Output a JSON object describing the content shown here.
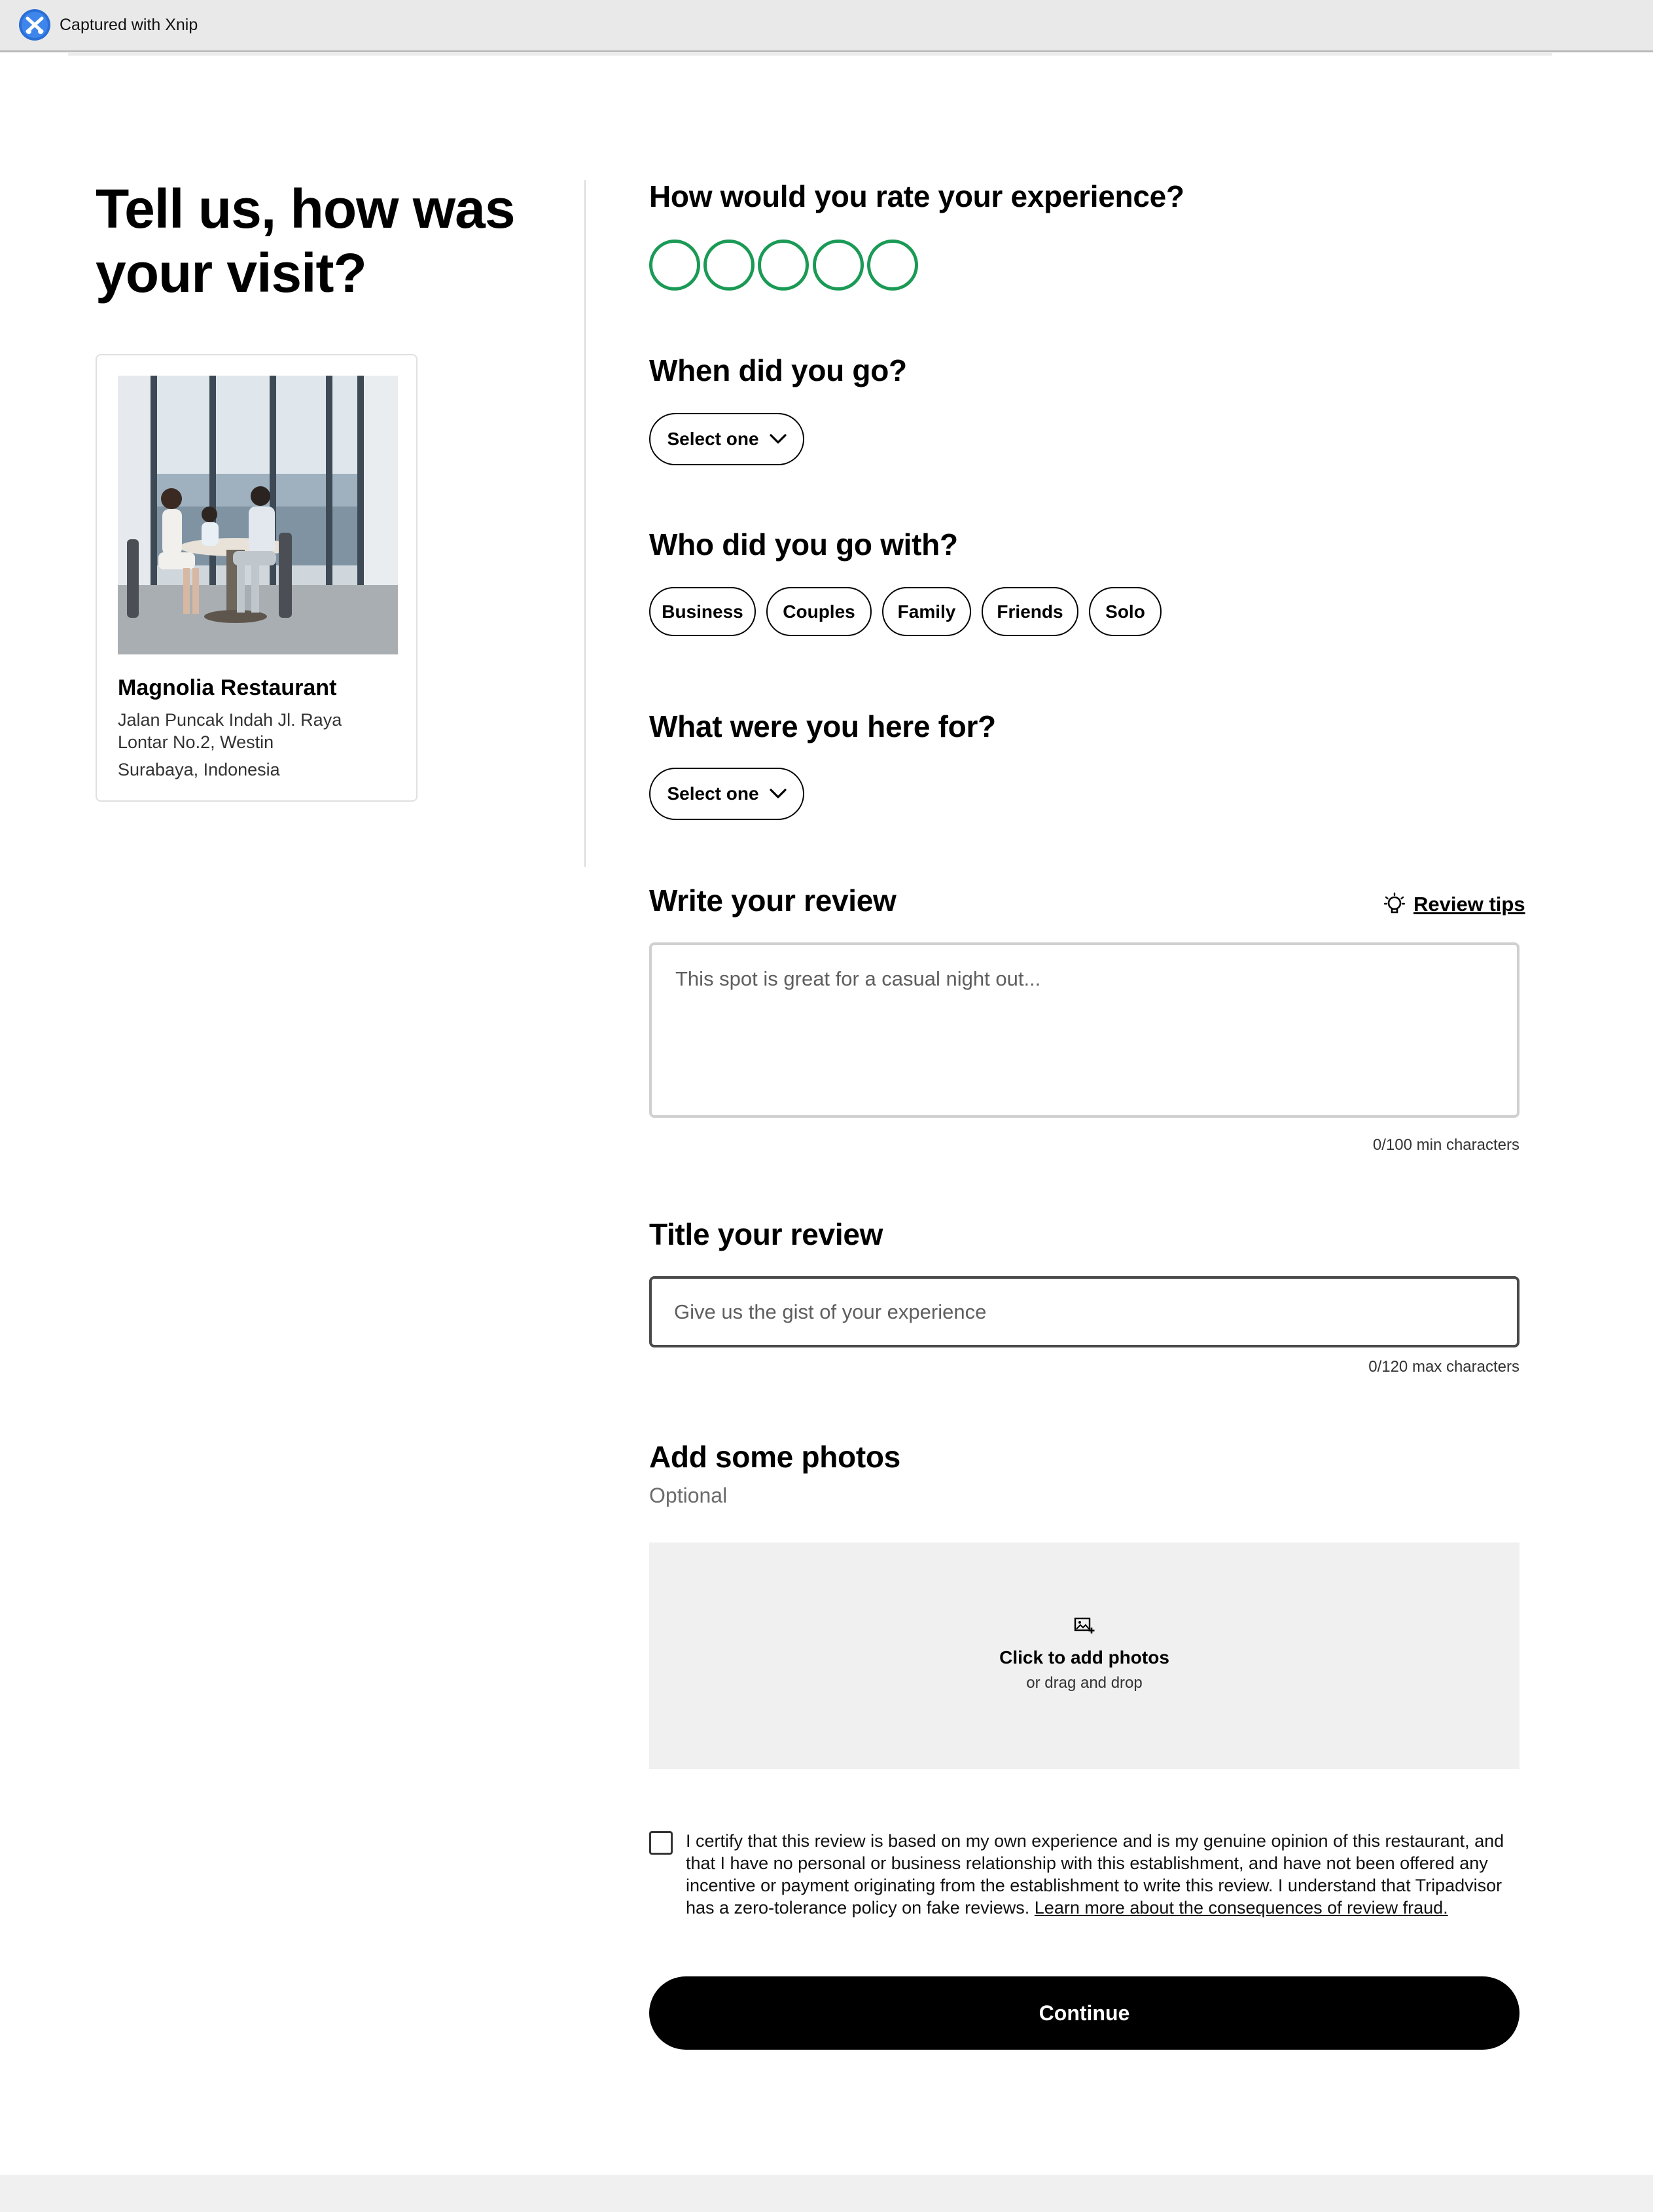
{
  "capture_bar": {
    "label": "Captured with Xnip"
  },
  "page_title": "Tell us, how was your visit?",
  "restaurant": {
    "name": "Magnolia Restaurant",
    "address_lines": [
      "Jalan Puncak Indah Jl. Raya",
      "Lontar No.2, Westin",
      "Surabaya, Indonesia"
    ]
  },
  "rating": {
    "heading": "How would you rate your experience?",
    "max": 5,
    "value": 0,
    "color": "#1a9a55"
  },
  "when": {
    "heading": "When did you go?",
    "select_label": "Select one"
  },
  "who": {
    "heading": "Who did you go with?",
    "options": [
      "Business",
      "Couples",
      "Family",
      "Friends",
      "Solo"
    ]
  },
  "purpose": {
    "heading": "What were you here for?",
    "select_label": "Select one"
  },
  "review": {
    "heading": "Write your review",
    "tips_label": "Review tips",
    "placeholder": "This spot is great for a casual night out...",
    "counter": "0/100 min characters"
  },
  "title": {
    "heading": "Title your review",
    "placeholder": "Give us the gist of your experience",
    "counter": "0/120 max characters"
  },
  "photos": {
    "heading": "Add some photos",
    "optional_label": "Optional",
    "click_label": "Click to add photos",
    "drag_label": "or drag and drop"
  },
  "certify": {
    "text": "I certify that this review is based on my own experience and is my genuine opinion of this restaurant, and that I have no personal or business relationship with this establishment, and have not been offered any incentive or payment originating from the establishment to write this review. I understand that Tripadvisor has a zero-tolerance policy on fake reviews.",
    "link_label": "Learn more about the consequences of review fraud.",
    "checked": false
  },
  "continue_label": "Continue",
  "icons": {
    "capture_logo": "xnip-logo-icon",
    "chevron": "chevron-down-icon",
    "lightbulb": "lightbulb-icon",
    "add_photo": "add-photo-icon",
    "checkbox": "checkbox-icon"
  }
}
